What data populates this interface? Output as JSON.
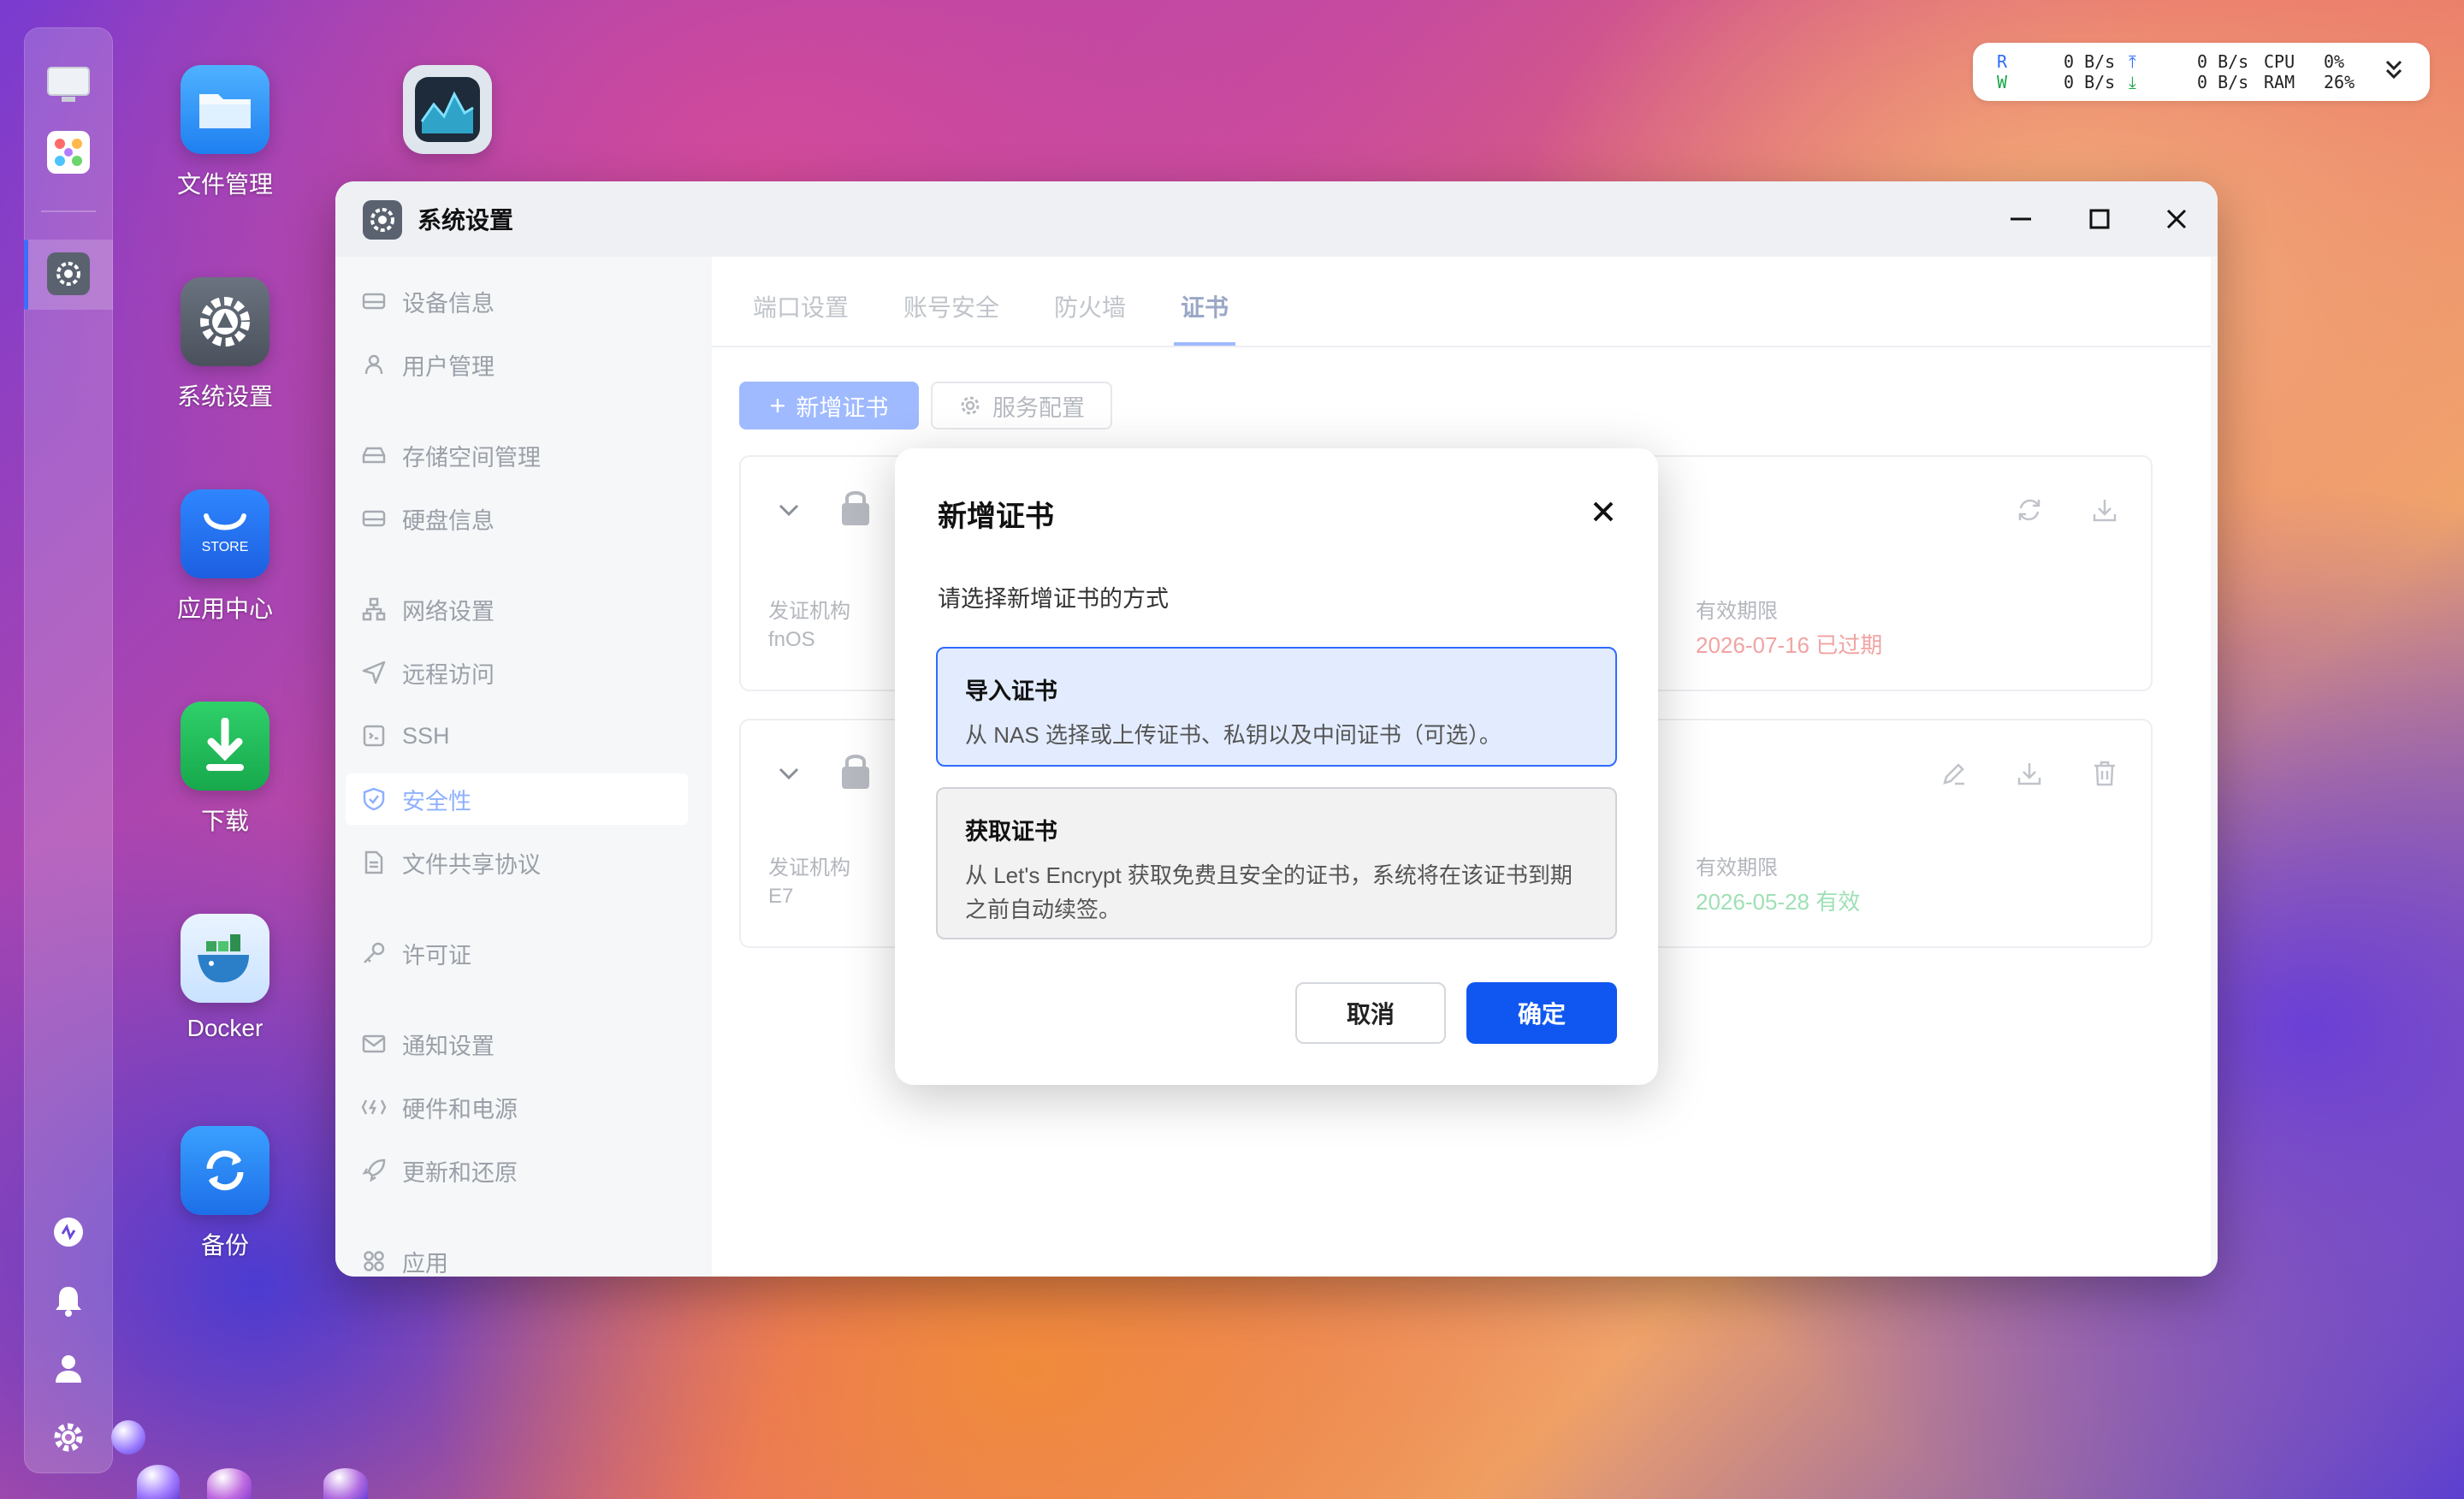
{
  "desktop": {
    "icons": [
      {
        "label": "文件管理"
      },
      {
        "label": "系统设置"
      },
      {
        "label": "应用中心",
        "badge": "STORE"
      },
      {
        "label": "下载"
      },
      {
        "label": "Docker"
      },
      {
        "label": "备份"
      }
    ]
  },
  "monitor": {
    "r_label": "R",
    "w_label": "W",
    "r_rate1": "0 B/s",
    "w_rate1": "0 B/s",
    "r_rate2": "0 B/s",
    "w_rate2": "0 B/s",
    "cpu_label": "CPU",
    "ram_label": "RAM",
    "cpu_value": "0%",
    "ram_value": "26%",
    "colors": {
      "r": "#2f6bff",
      "w": "#1aa64a"
    }
  },
  "window": {
    "title": "系统设置",
    "sidebar": [
      {
        "label": "设备信息",
        "icon": "device-icon"
      },
      {
        "label": "用户管理",
        "icon": "user-icon"
      },
      {
        "label": "存储空间管理",
        "icon": "storage-icon"
      },
      {
        "label": "硬盘信息",
        "icon": "disk-icon"
      },
      {
        "label": "网络设置",
        "icon": "network-icon"
      },
      {
        "label": "远程访问",
        "icon": "send-icon"
      },
      {
        "label": "SSH",
        "icon": "ssh-icon"
      },
      {
        "label": "安全性",
        "icon": "shield-icon",
        "active": true
      },
      {
        "label": "文件共享协议",
        "icon": "file-icon"
      },
      {
        "label": "许可证",
        "icon": "key-icon"
      },
      {
        "label": "通知设置",
        "icon": "mail-icon"
      },
      {
        "label": "硬件和电源",
        "icon": "power-icon"
      },
      {
        "label": "更新和还原",
        "icon": "rocket-icon"
      },
      {
        "label": "应用",
        "icon": "apps-icon"
      }
    ],
    "tabs": [
      {
        "label": "端口设置"
      },
      {
        "label": "账号安全"
      },
      {
        "label": "防火墙"
      },
      {
        "label": "证书",
        "active": true
      }
    ],
    "toolbar": {
      "add_label": "新增证书",
      "config_label": "服务配置"
    },
    "certs": [
      {
        "issuer_label": "发证机构",
        "issuer": "fnOS",
        "validity_label": "有效期限",
        "validity": "2026-07-16 已过期",
        "validity_color": "#f2a3a3"
      },
      {
        "issuer_label": "发证机构",
        "issuer": "E7",
        "validity_label": "有效期限",
        "validity": "2026-05-28 有效",
        "validity_color": "#9fe0b5"
      }
    ]
  },
  "dialog": {
    "title": "新增证书",
    "subtitle": "请选择新增证书的方式",
    "options": [
      {
        "title": "导入证书",
        "desc": "从 NAS 选择或上传证书、私钥以及中间证书（可选）。",
        "selected": true
      },
      {
        "title": "获取证书",
        "desc": "从 Let's Encrypt 获取免费且安全的证书，系统将在该证书到期之前自动续签。",
        "selected": false
      }
    ],
    "cancel_label": "取消",
    "ok_label": "确定",
    "accent": "#0f57f0"
  }
}
